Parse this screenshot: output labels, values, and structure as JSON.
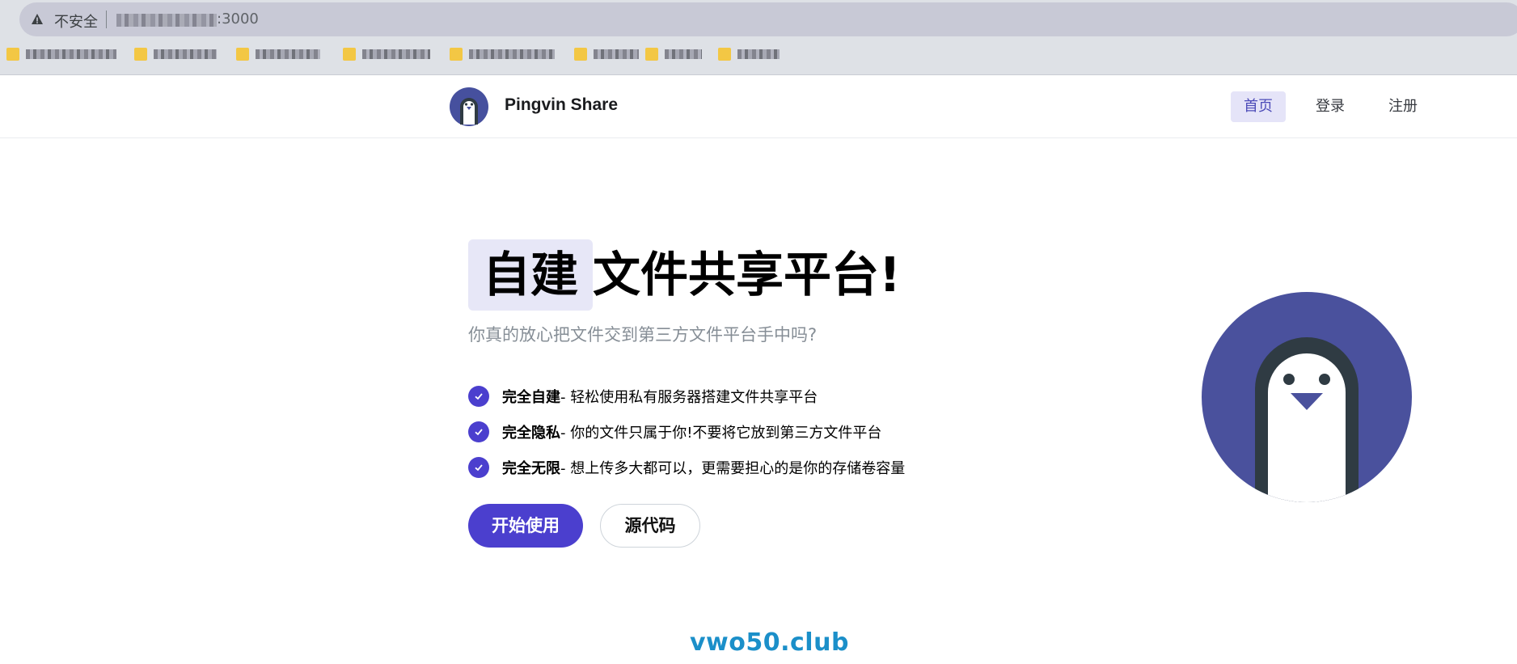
{
  "browser": {
    "security_label": "不安全",
    "url_visible": ":3000",
    "warn_icon": "warning-triangle-icon",
    "bookmark_icon": "folder-icon"
  },
  "header": {
    "brand": "Pingvin Share",
    "nav": {
      "home": "首页",
      "login": "登录",
      "signup": "注册"
    }
  },
  "hero": {
    "title_highlight": "自建",
    "title_rest": "文件共享平台!",
    "subtitle": "你真的放心把文件交到第三方文件平台手中吗?",
    "features": [
      {
        "title": "完全自建",
        "desc": " - 轻松使用私有服务器搭建文件共享平台"
      },
      {
        "title": "完全隐私",
        "desc": " - 你的文件只属于你!不要将它放到第三方文件平台"
      },
      {
        "title": "完全无限",
        "desc": " - 想上传多大都可以，更需要担心的是你的存储卷容量"
      }
    ],
    "buttons": {
      "start": "开始使用",
      "source": "源代码"
    }
  },
  "watermark": "vwo50.club",
  "colors": {
    "accent": "#4b3fce",
    "logo_bg": "#46509e",
    "penguin_dark": "#2f3b43"
  }
}
